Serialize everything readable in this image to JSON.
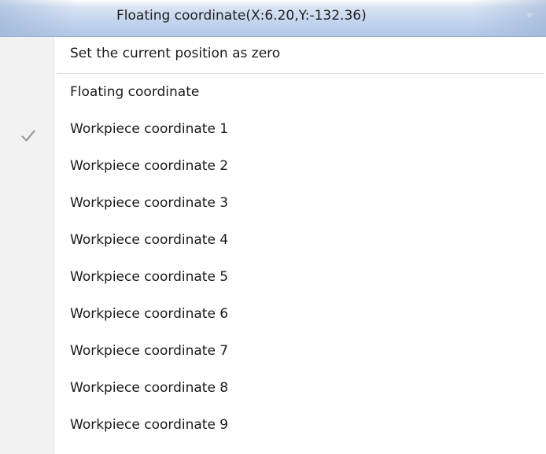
{
  "header": {
    "title": "Floating coordinate(X:6.20,Y:-132.36)",
    "icon": "dropdown-arrow-icon"
  },
  "menu": {
    "checked_index": 0,
    "set_zero_label": "Set the current position as zero",
    "items": [
      {
        "label": "Floating coordinate"
      },
      {
        "label": "Workpiece coordinate 1"
      },
      {
        "label": "Workpiece coordinate 2"
      },
      {
        "label": "Workpiece coordinate 3"
      },
      {
        "label": "Workpiece coordinate 4"
      },
      {
        "label": "Workpiece coordinate 5"
      },
      {
        "label": "Workpiece coordinate 6"
      },
      {
        "label": "Workpiece coordinate 7"
      },
      {
        "label": "Workpiece coordinate 8"
      },
      {
        "label": "Workpiece coordinate 9"
      }
    ]
  },
  "colors": {
    "header_gradient_top": "#dbe5f3",
    "header_gradient_bottom": "#b3c8e6",
    "gutter": "#f2f2f2",
    "check": "#9a9a9a"
  }
}
